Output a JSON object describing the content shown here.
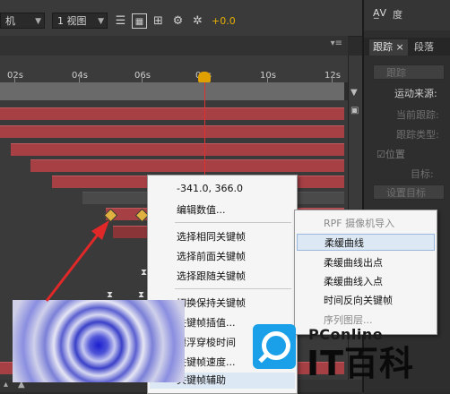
{
  "toolbar": {
    "camera_select": "机",
    "view_select": "1 视图",
    "offset_value": "+0.0"
  },
  "ruler": {
    "labels": [
      "02s",
      "04s",
      "06s",
      "08s",
      "10s",
      "12s"
    ]
  },
  "context_menu_left": {
    "items": [
      {
        "label": "-341.0, 366.0"
      },
      {
        "label": "编辑数值..."
      },
      {
        "label": "选择相同关键帧"
      },
      {
        "label": "选择前面关键帧"
      },
      {
        "label": "选择跟随关键帧"
      },
      {
        "label": "切换保持关键帧"
      },
      {
        "label": "关键帧插值..."
      },
      {
        "label": "漂浮穿梭时间"
      },
      {
        "label": "关键帧速度..."
      },
      {
        "label": "关键帧辅助"
      }
    ]
  },
  "context_menu_right": {
    "items": [
      {
        "label": "RPF 摄像机导入"
      },
      {
        "label": "柔缓曲线"
      },
      {
        "label": "柔缓曲线出点"
      },
      {
        "label": "柔缓曲线入点"
      },
      {
        "label": "时间反向关键帧"
      },
      {
        "label": "序列图层..."
      }
    ]
  },
  "right_panel": {
    "top_label": "度",
    "tabs": [
      {
        "label": "跟踪"
      },
      {
        "label": "段落"
      }
    ],
    "track_button": "跟踪",
    "motion_source_label": "运动来源:",
    "current_track_label": "当前跟踪:",
    "track_type_label": "跟踪类型:",
    "position_label": "位置",
    "target_label": "目标:",
    "set_target_button": "设置目标"
  },
  "watermark": {
    "brand_top": "PConline",
    "brand_main": "IT百科"
  }
}
